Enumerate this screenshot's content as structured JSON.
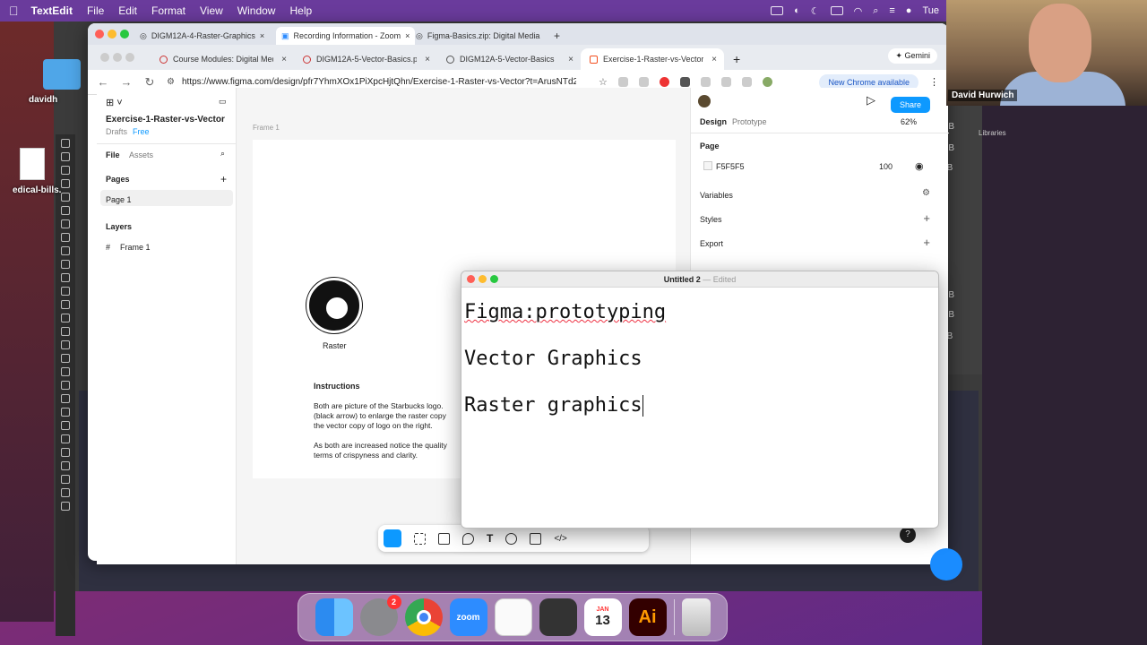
{
  "menubar": {
    "app": "TextEdit",
    "items": [
      "File",
      "Edit",
      "Format",
      "View",
      "Window",
      "Help"
    ],
    "clock": "Tue"
  },
  "desktop": {
    "folder_label": "davidh",
    "file_label": "edical-bills."
  },
  "chrome": {
    "top_tabs": [
      "DIGM12A-4-Raster-Graphics",
      "Recording Information - Zoom",
      "Figma-Basics.zip: Digital Media"
    ],
    "tabs": [
      {
        "label": "Course Modules: Digital Media"
      },
      {
        "label": "DIGM12A-5-Vector-Basics.pdf"
      },
      {
        "label": "DIGM12A-5-Vector-Basics"
      },
      {
        "label": "Exercise-1-Raster-vs-Vector"
      }
    ],
    "gemini": "Gemini",
    "url": "https://www.figma.com/design/pfr7YhmXOx1PiXpcHjtQhn/Exercise-1-Raster-vs-Vector?t=ArusNTd2fd...",
    "new_chrome": "New Chrome available"
  },
  "figma": {
    "file_name": "Exercise-1-Raster-vs-Vector",
    "drafts": "Drafts",
    "plan": "Free",
    "tab_file": "File",
    "tab_assets": "Assets",
    "pages_label": "Pages",
    "page1": "Page 1",
    "layers_label": "Layers",
    "layer1": "Frame 1",
    "frame_label": "Frame 1",
    "raster_caption": "Raster",
    "instructions_title": "Instructions",
    "instructions_p1a": "Both are picture of the Starbucks logo.",
    "instructions_p1b": "(black arrow) to enlarge the raster copy",
    "instructions_p1c": "the vector copy of logo on the right.",
    "instructions_p2a": "As both are increased notice the quality",
    "instructions_p2b": "terms of crispyness and clarity.",
    "share": "Share",
    "tab_design": "Design",
    "tab_prototype": "Prototype",
    "zoom": "62%",
    "page_section": "Page",
    "page_color": "F5F5F5",
    "page_opacity": "100",
    "variables": "Variables",
    "styles": "Styles",
    "export": "Export"
  },
  "textedit": {
    "title": "Untitled 2",
    "edited": "Edited",
    "lines": [
      "Figma:prototyping",
      "Vector Graphics",
      "Raster graphics"
    ]
  },
  "video": {
    "name": "David Hurwich"
  },
  "ai_panel": {
    "labels": [
      "MB",
      "MB",
      "KB",
      "MB",
      "MB",
      "KB"
    ],
    "libraries": "Libraries"
  },
  "dock": {
    "apps": [
      "Finder",
      "System Settings",
      "Chrome",
      "Zoom",
      "TextEdit",
      "Calculator",
      "Calendar",
      "Illustrator",
      "Trash"
    ],
    "settings_badge": "2",
    "calendar_month": "JAN",
    "calendar_day": "13",
    "zoom_label": "zoom",
    "ai_label": "Ai"
  },
  "colors": {
    "figma_blue": "#0d99ff",
    "ai_red": "#330000",
    "zoom_blue": "#2d8cff"
  }
}
